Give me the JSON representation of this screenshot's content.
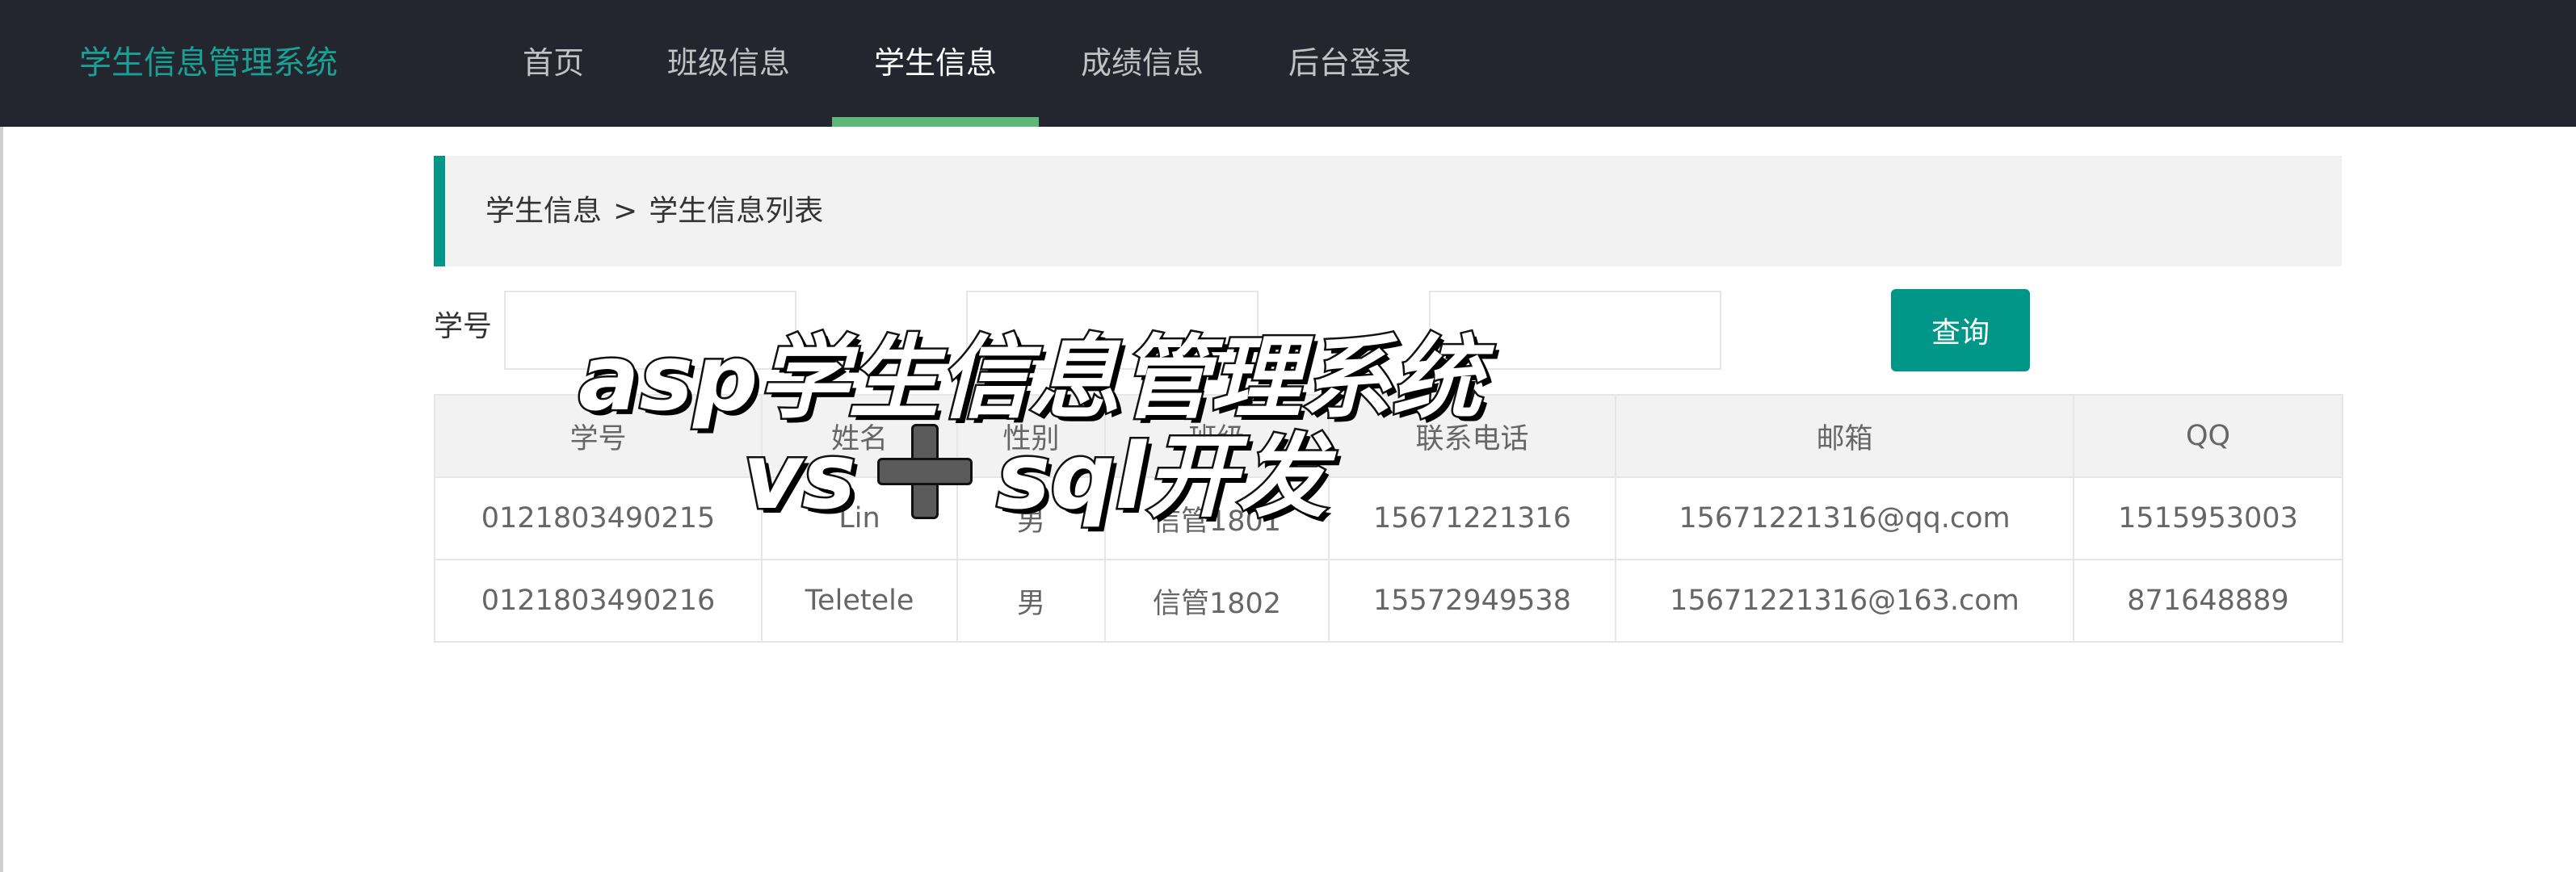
{
  "app": {
    "title": "学生信息管理系统"
  },
  "nav": {
    "items": [
      {
        "label": "首页",
        "active": false
      },
      {
        "label": "班级信息",
        "active": false
      },
      {
        "label": "学生信息",
        "active": true
      },
      {
        "label": "成绩信息",
        "active": false
      },
      {
        "label": "后台登录",
        "active": false
      }
    ]
  },
  "breadcrumb": {
    "parent": "学生信息",
    "separator": ">",
    "current": "学生信息列表"
  },
  "search": {
    "student_id_label": "学号",
    "student_id_value": "",
    "name_value": "",
    "class_value": "",
    "query_label": "查询"
  },
  "table": {
    "headers": [
      "学号",
      "姓名",
      "性别",
      "班级",
      "联系电话",
      "邮箱",
      "QQ"
    ],
    "rows": [
      [
        "0121803490215",
        "Lin",
        "男",
        "信管1801",
        "15671221316",
        "15671221316@qq.com",
        "1515953003"
      ],
      [
        "0121803490216",
        "Teletele",
        "男",
        "信管1802",
        "15572949538",
        "15671221316@163.com",
        "871648889"
      ]
    ]
  },
  "overlay": {
    "line1": "asp学生信息管理系统",
    "line2_prefix": "vs",
    "line2_suffix": "sql开发",
    "icon": "plus-icon"
  },
  "colors": {
    "navbar_bg": "#23262e",
    "brand": "#1aa094",
    "accent": "#009688",
    "active_underline": "#5fb878"
  }
}
